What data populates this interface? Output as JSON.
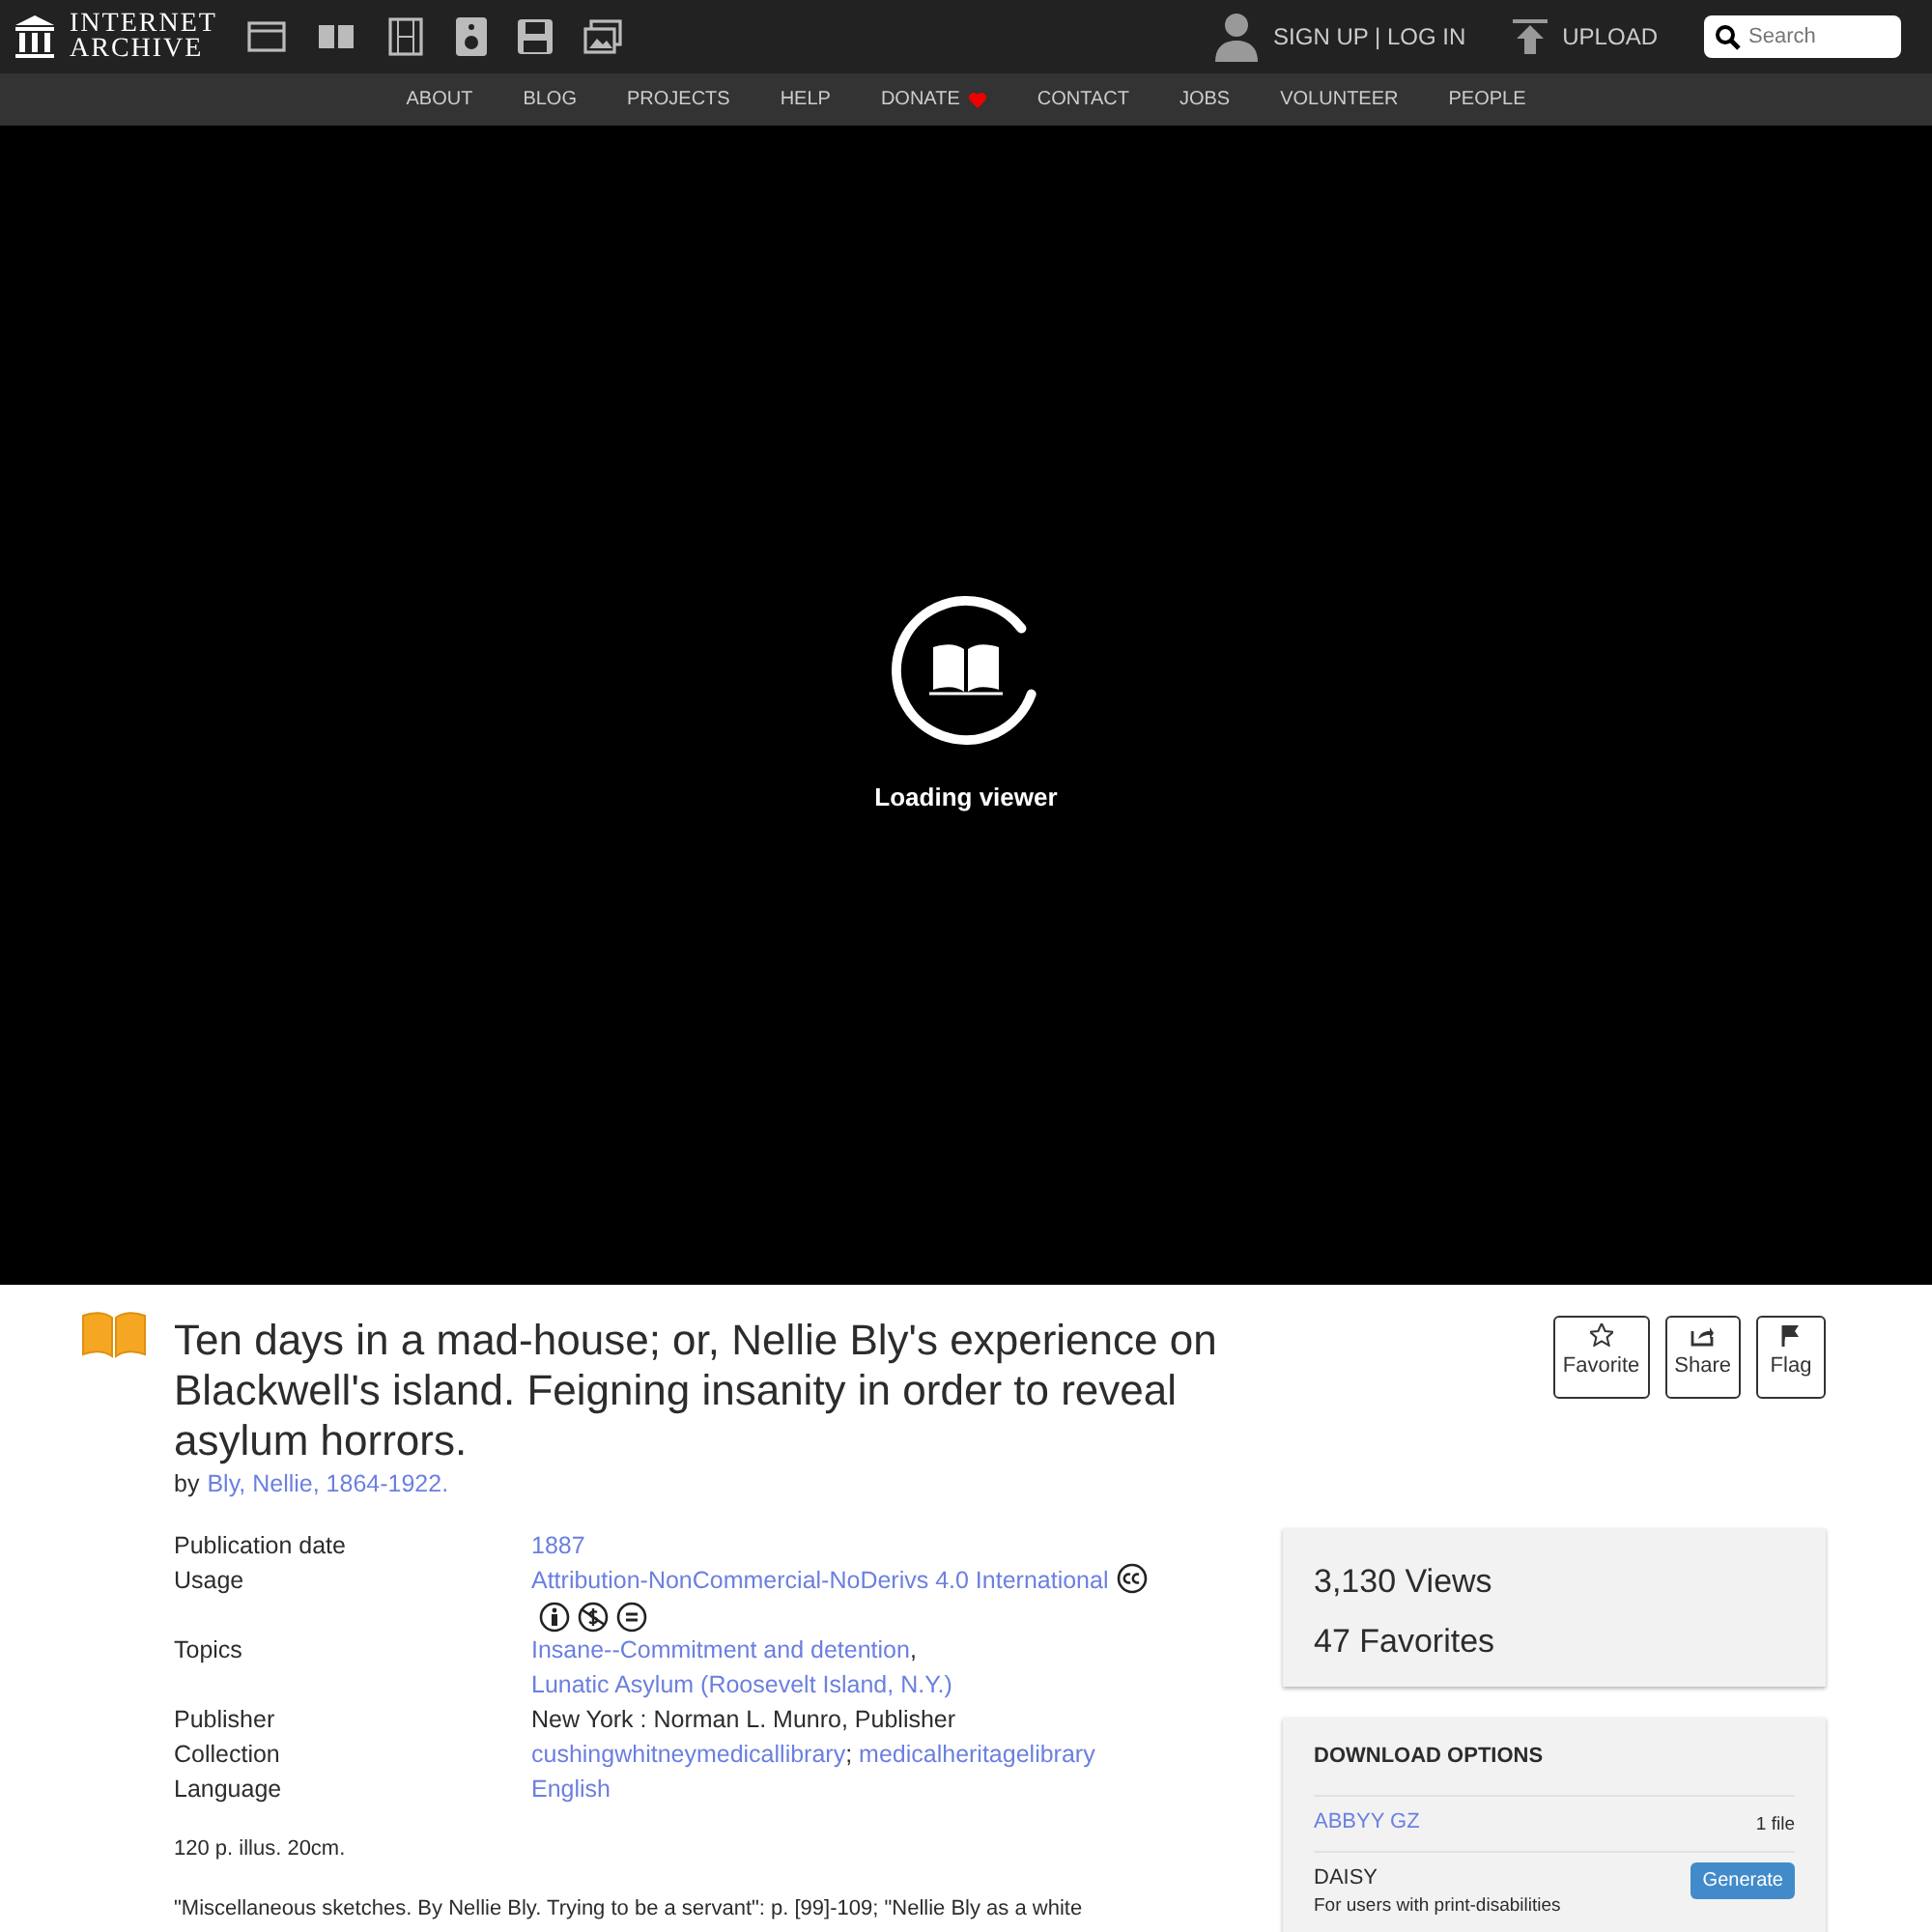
{
  "header": {
    "logo_lines": [
      "INTERNET",
      "ARCHIVE"
    ],
    "account": "SIGN UP | LOG IN",
    "upload": "UPLOAD",
    "search": {
      "placeholder": "Search"
    }
  },
  "nav": [
    {
      "label": "ABOUT",
      "kind": "plain"
    },
    {
      "label": "BLOG",
      "kind": "plain"
    },
    {
      "label": "PROJECTS",
      "kind": "plain"
    },
    {
      "label": "HELP",
      "kind": "plain"
    },
    {
      "label": "DONATE",
      "kind": "donate"
    },
    {
      "label": "CONTACT",
      "kind": "plain"
    },
    {
      "label": "JOBS",
      "kind": "plain"
    },
    {
      "label": "VOLUNTEER",
      "kind": "plain"
    },
    {
      "label": "PEOPLE",
      "kind": "plain"
    }
  ],
  "viewer": {
    "status": "Loading viewer"
  },
  "item": {
    "title": "Ten days in a mad-house; or, Nellie Bly's experience on Blackwell's island. Feigning insanity in order to reveal asylum horrors.",
    "by": "by",
    "author": "Bly, Nellie, 1864-1922.",
    "actions": [
      {
        "label": "Favorite",
        "kind": "favorite"
      },
      {
        "label": "Share",
        "kind": "share"
      },
      {
        "label": "Flag",
        "kind": "flag"
      }
    ]
  },
  "metadata": [
    {
      "label": "Publication date",
      "kind": "plain",
      "parts": [
        {
          "text": "1887",
          "link": true
        }
      ]
    },
    {
      "label": "Usage",
      "kind": "license",
      "parts": [
        {
          "text": "Attribution-NonCommercial-NoDerivs 4.0 International",
          "link": true
        }
      ]
    },
    {
      "label": "Topics",
      "kind": "plain",
      "parts": [
        {
          "text": "Insane--Commitment and detention",
          "link": true
        },
        {
          "text": ",",
          "link": false
        },
        {
          "text": "Lunatic Asylum (Roosevelt Island, N.Y.)",
          "link": true
        }
      ]
    },
    {
      "label": "Publisher",
      "kind": "plain",
      "parts": [
        {
          "text": "New York : Norman L. Munro, Publisher",
          "link": false
        }
      ]
    },
    {
      "label": "Collection",
      "kind": "plain",
      "parts": [
        {
          "text": "cushingwhitneymedicallibrary",
          "link": true
        },
        {
          "text": ";",
          "link": false
        },
        {
          "text": "medicalheritagelibrary",
          "link": true
        }
      ]
    },
    {
      "label": "Language",
      "kind": "plain",
      "parts": [
        {
          "text": "English",
          "link": true
        }
      ]
    }
  ],
  "notes": [
    "120 p. illus. 20cm.",
    "\"Miscellaneous sketches. By Nellie Bly. Trying to be a servant\": p. [99]-109; \"Nellie Bly as a white"
  ],
  "stats": [
    {
      "count": "3,130",
      "label": "Views"
    },
    {
      "count": "47",
      "label": "Favorites"
    }
  ],
  "downloads": {
    "title": "DOWNLOAD OPTIONS",
    "items": [
      {
        "name": "ABBYY GZ",
        "link": true,
        "meta": "1 file"
      },
      {
        "name": "DAISY",
        "link": false,
        "sub": "For users with print-disabilities",
        "action": "Generate"
      }
    ]
  }
}
